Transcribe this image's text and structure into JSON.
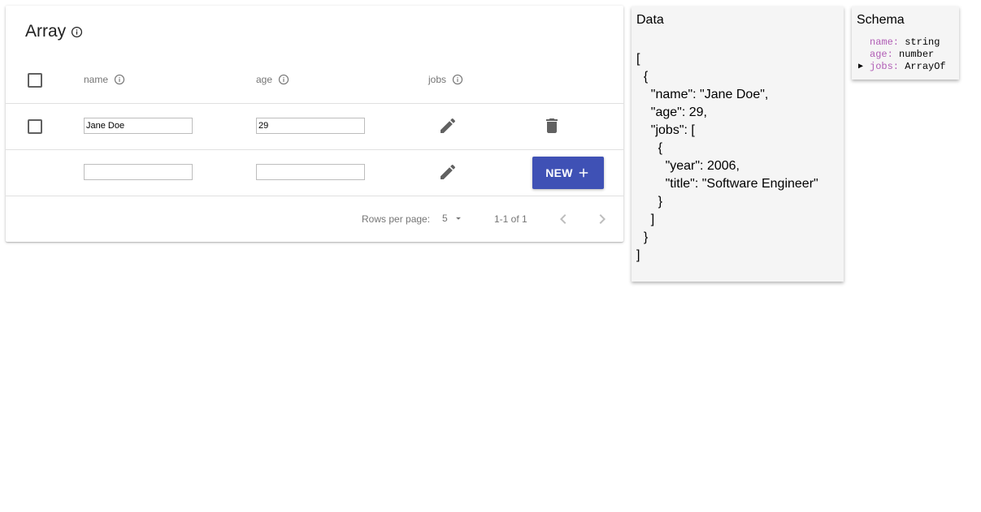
{
  "array_card": {
    "title": "Array",
    "columns": [
      {
        "label": "name"
      },
      {
        "label": "age"
      },
      {
        "label": "jobs"
      }
    ],
    "rows": [
      {
        "name": "Jane Doe",
        "age": "29"
      }
    ],
    "new_row": {
      "name": "",
      "age": ""
    },
    "new_button_label": "NEW",
    "pagination": {
      "rows_per_page_label": "Rows per page:",
      "rows_per_page_value": "5",
      "range_text": "1-1 of 1"
    },
    "accent_color": "#3f51b5"
  },
  "data_panel": {
    "title": "Data",
    "json_text": "[\n  {\n    \"name\": \"Jane Doe\",\n    \"age\": 29,\n    \"jobs\": [\n      {\n        \"year\": 2006,\n        \"title\": \"Software Engineer\"\n      }\n    ]\n  }\n]"
  },
  "schema_panel": {
    "title": "Schema",
    "fields": [
      {
        "arrow": "",
        "key": "name:",
        "type": " string"
      },
      {
        "arrow": "▶",
        "key": "age:",
        "type": " number"
      },
      {
        "arrow": "▶",
        "key": "jobs:",
        "type": " ArrayOf"
      }
    ]
  }
}
